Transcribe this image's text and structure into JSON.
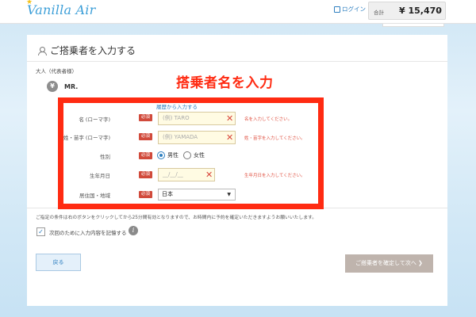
{
  "header": {
    "logo_text": "Vanilla Air",
    "login_label": "ログイン",
    "total_label": "合計",
    "total_amount": "¥ 15,470",
    "accent": "#3d9fd8"
  },
  "form": {
    "section_title": "ご搭乗者を入力する",
    "adult_label": "大人（代表者様）",
    "avatar_glyph": "¥",
    "title_prefix": "MR.",
    "history_link": "履歴から入力する",
    "required_badge": "必須",
    "fields": {
      "first_name": {
        "label": "名 (ローマ字)",
        "placeholder": "(例) TARO",
        "error": "名を入力してください。"
      },
      "last_name": {
        "label": "姓・苗字 (ローマ字)",
        "placeholder": "(例) YAMADA",
        "error": "姓・苗字を入力してください。"
      },
      "gender": {
        "label": "性別",
        "options": [
          "男性",
          "女性"
        ],
        "selected": "男性"
      },
      "birthdate": {
        "label": "生年月日",
        "placeholder": "__/__/__",
        "error": "生年月日を入力してください。"
      },
      "country": {
        "label": "居住国・地域",
        "value": "日本"
      }
    },
    "notice": "ご指定の条件は右のボタンをクリックしてから25分間有効となりますので、お時間内に予約を確定いただきますようお願いいたします。",
    "remember_label": "次回のために入力内容を記憶する",
    "remember_checked": true,
    "back_button": "戻る",
    "confirm_button": "ご搭乗者を確定して次へ ❯"
  },
  "annotation": {
    "title": "搭乗者名を入力",
    "color": "#ff2b12"
  }
}
